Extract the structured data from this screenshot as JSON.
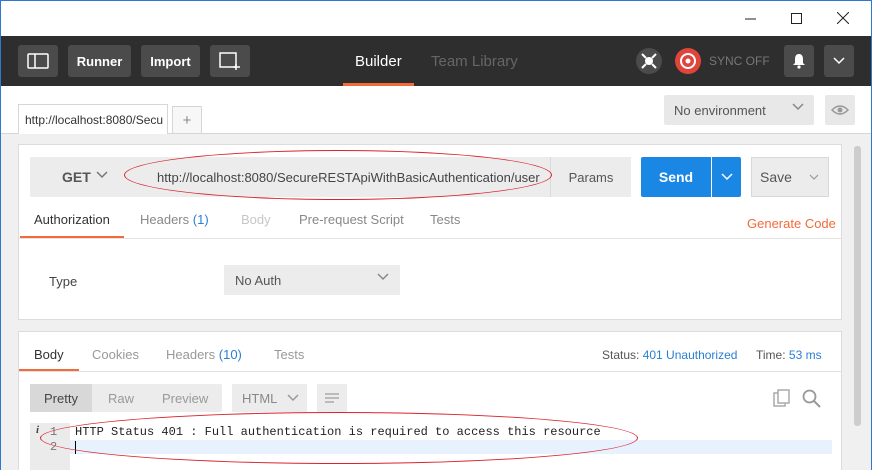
{
  "toolbar": {
    "runner_label": "Runner",
    "import_label": "Import",
    "tabs": [
      {
        "label": "Builder",
        "active": true
      },
      {
        "label": "Team Library",
        "active": false
      }
    ],
    "sync_label": "SYNC OFF",
    "accent_color": "#f26b3a"
  },
  "request_tabs": {
    "tab_label": "http://localhost:8080/Secu",
    "add_tab_icon": "plus-icon"
  },
  "environment": {
    "selected": "No environment"
  },
  "request": {
    "method": "GET",
    "url": "http://localhost:8080/SecureRESTApiWithBasicAuthentication/user",
    "params_label": "Params",
    "send_label": "Send",
    "save_label": "Save",
    "send_color": "#1b87e5"
  },
  "request_subtabs": {
    "authorization": "Authorization",
    "headers": "Headers",
    "headers_count": "(1)",
    "body": "Body",
    "prerequest": "Pre-request Script",
    "tests": "Tests",
    "generate_code": "Generate Code"
  },
  "auth": {
    "type_label": "Type",
    "type_value": "No Auth"
  },
  "response": {
    "tabs": {
      "body": "Body",
      "cookies": "Cookies",
      "headers": "Headers",
      "headers_count": "(10)",
      "tests": "Tests"
    },
    "status_label": "Status:",
    "status_value": "401 Unauthorized",
    "time_label": "Time:",
    "time_value": "53 ms",
    "formats": {
      "pretty": "Pretty",
      "raw": "Raw",
      "preview": "Preview",
      "language": "HTML"
    },
    "lines": [
      {
        "num": "1",
        "text": "HTTP Status 401 : Full authentication is required to access this resource"
      },
      {
        "num": "2",
        "text": ""
      }
    ],
    "info_marker": "i"
  },
  "annotation_color": "#d9232e"
}
